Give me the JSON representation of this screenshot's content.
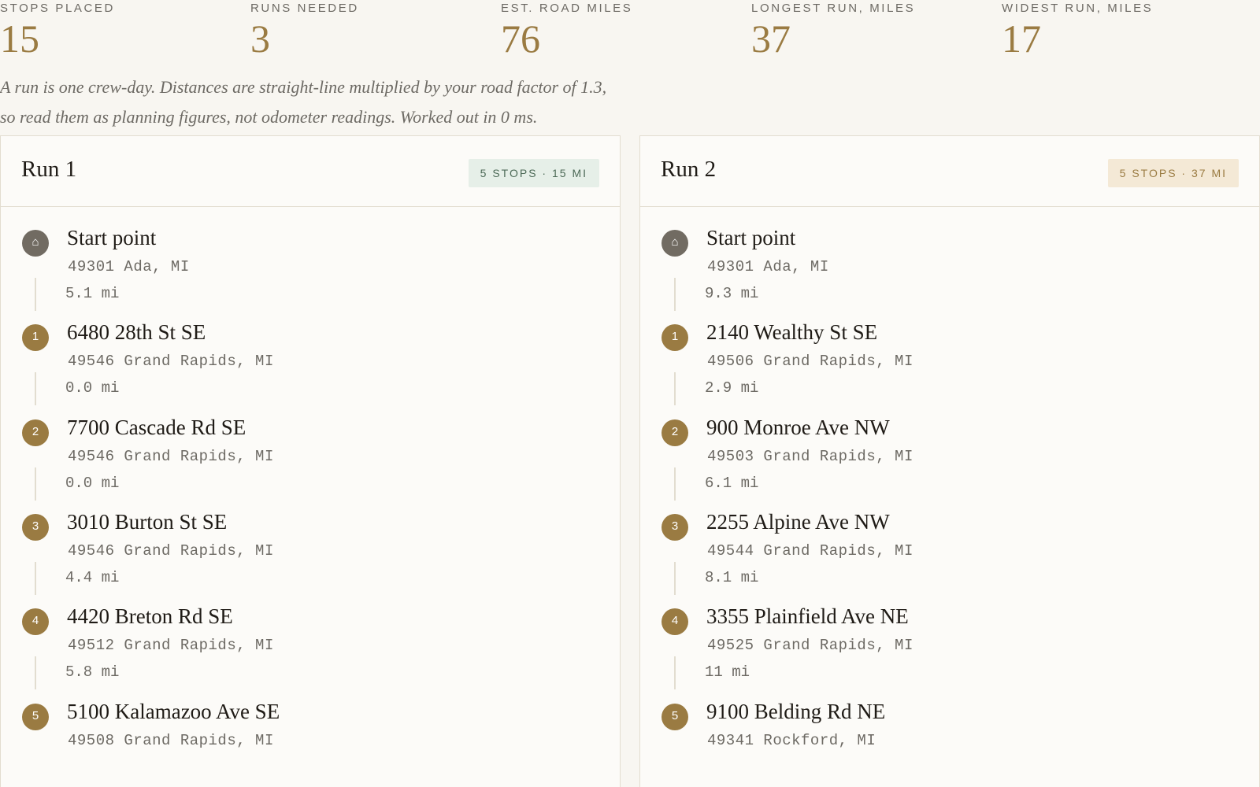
{
  "summary": {
    "stops_placed": {
      "label": "STOPS PLACED",
      "value": "15"
    },
    "runs_needed": {
      "label": "RUNS NEEDED",
      "value": "3"
    },
    "est_road_miles": {
      "label": "EST. ROAD MILES",
      "value": "76"
    },
    "longest_run_miles": {
      "label": "LONGEST RUN, MILES",
      "value": "37"
    },
    "widest_run_miles": {
      "label": "WIDEST RUN, MILES",
      "value": "17"
    }
  },
  "note": {
    "line1": "A run is one crew-day. Distances are straight-line multiplied by your road factor of 1.3,",
    "line2": "so read them as planning figures, not odometer readings. Worked out in 0 ms."
  },
  "icons": {
    "home": "⌂",
    "home_icon": "home-icon"
  },
  "colors": {
    "accent": "#9a7b42",
    "start_marker": "#716b62",
    "badge_green_bg": "#e6efe8",
    "badge_green_fg": "#4d6a57",
    "badge_tan_bg": "#f4e9d6",
    "badge_tan_fg": "#9a7b42"
  },
  "runs": [
    {
      "title": "Run 1",
      "badge": "5 STOPS · 15 MI",
      "start": {
        "name": "Start point",
        "address": "49301 Ada, MI"
      },
      "stops": [
        {
          "number": "1",
          "leg": "5.1 mi",
          "name": "6480 28th St SE",
          "address": "49546 Grand Rapids, MI"
        },
        {
          "number": "2",
          "leg": "0.0 mi",
          "name": "7700 Cascade Rd SE",
          "address": "49546 Grand Rapids, MI"
        },
        {
          "number": "3",
          "leg": "0.0 mi",
          "name": "3010 Burton St SE",
          "address": "49546 Grand Rapids, MI"
        },
        {
          "number": "4",
          "leg": "4.4 mi",
          "name": "4420 Breton Rd SE",
          "address": "49512 Grand Rapids, MI"
        },
        {
          "number": "5",
          "leg": "5.8 mi",
          "name": "5100 Kalamazoo Ave SE",
          "address": "49508 Grand Rapids, MI"
        }
      ]
    },
    {
      "title": "Run 2",
      "badge": "5 STOPS · 37 MI",
      "start": {
        "name": "Start point",
        "address": "49301 Ada, MI"
      },
      "stops": [
        {
          "number": "1",
          "leg": "9.3 mi",
          "name": "2140 Wealthy St SE",
          "address": "49506 Grand Rapids, MI"
        },
        {
          "number": "2",
          "leg": "2.9 mi",
          "name": "900 Monroe Ave NW",
          "address": "49503 Grand Rapids, MI"
        },
        {
          "number": "3",
          "leg": "6.1 mi",
          "name": "2255 Alpine Ave NW",
          "address": "49544 Grand Rapids, MI"
        },
        {
          "number": "4",
          "leg": "8.1 mi",
          "name": "3355 Plainfield Ave NE",
          "address": "49525 Grand Rapids, MI"
        },
        {
          "number": "5",
          "leg": "11 mi",
          "name": "9100 Belding Rd NE",
          "address": "49341 Rockford, MI"
        }
      ]
    }
  ]
}
